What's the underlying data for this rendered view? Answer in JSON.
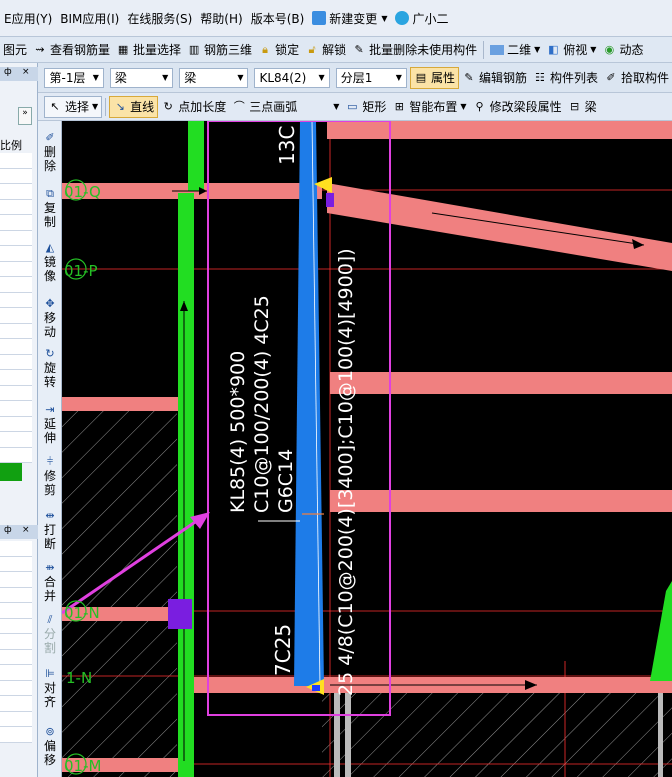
{
  "menu": {
    "items": [
      {
        "label": "E应用(Y)"
      },
      {
        "label": "BIM应用(I)"
      },
      {
        "label": "在线服务(S)"
      },
      {
        "label": "帮助(H)"
      },
      {
        "label": "版本号(B)"
      },
      {
        "label": "新建变更"
      },
      {
        "label": "广小二"
      }
    ]
  },
  "toolbar1": {
    "items": [
      "图元",
      "查看钢筋量",
      "批量选择",
      "钢筋三维",
      "锁定",
      "解锁",
      "批量删除未使用构件",
      "二维",
      "俯视",
      "动态"
    ]
  },
  "toolbar2": {
    "floor": "第-1层",
    "category": "梁",
    "type": "梁",
    "element": "KL84(2)",
    "layer": "分层1",
    "buttons": [
      "属性",
      "编辑钢筋",
      "构件列表",
      "拾取构件"
    ]
  },
  "toolbar3": {
    "select": "选择",
    "line": "直线",
    "point_length": "点加长度",
    "arc": "三点画弧",
    "rect": "矩形",
    "smart": "智能布置",
    "modify": "修改梁段属性",
    "beam": "梁"
  },
  "leftpanel": {
    "header_pin": "ф",
    "header_x": "×",
    "scroll_btn": "»",
    "column_label": "比例"
  },
  "vtools": [
    {
      "icon": "✐",
      "label": "删除"
    },
    {
      "icon": "⧉",
      "label": "复制"
    },
    {
      "icon": "◭",
      "label": "镜像"
    },
    {
      "icon": "✥",
      "label": "移动"
    },
    {
      "icon": "↻",
      "label": "旋转"
    },
    {
      "icon": "⇥",
      "label": "延伸"
    },
    {
      "icon": "⫩",
      "label": "修剪"
    },
    {
      "icon": "⇹",
      "label": "打断"
    },
    {
      "icon": "⇻",
      "label": "合并"
    },
    {
      "icon": "⫽",
      "label": "分割"
    },
    {
      "icon": "⊫",
      "label": "对齐"
    },
    {
      "icon": "⊚",
      "label": "偏移"
    }
  ],
  "cad": {
    "axes": [
      "01-Q",
      "01-P",
      "01-N",
      "1-N",
      "01-M"
    ],
    "beam_label_1": "KL85(4) 500*900",
    "beam_label_2": "C10@100/200(4) 4C25",
    "beam_label_3": "G6C14",
    "seg_left": "7C25",
    "seg_right_bottom": "25 4/8(C10@200(4)[3400];C10@100(4)[4900])",
    "seg_top": "13C",
    "colors": {
      "background": "#000000",
      "beam_red": "#f08080",
      "column_green": "#22dd22",
      "selected_beam": "#1e7ce8",
      "highlight": "#e040e0",
      "axis_line": "#ff3030",
      "axis_bubble": "#25c025"
    }
  }
}
